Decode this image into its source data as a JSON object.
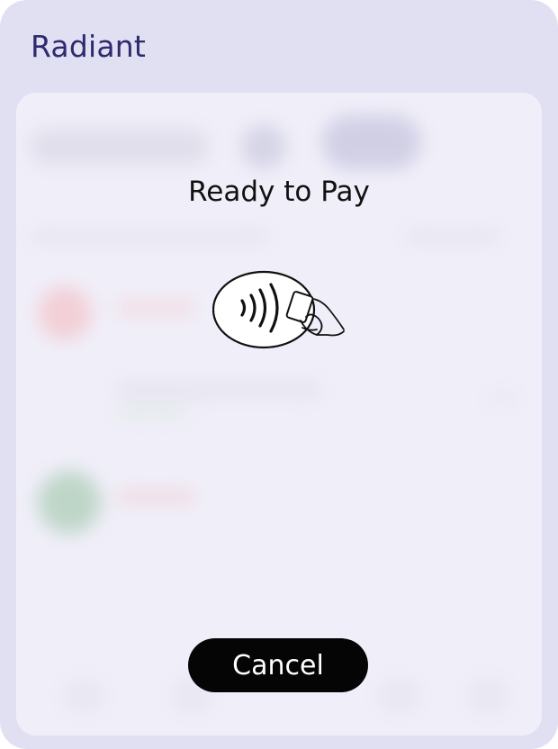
{
  "app": {
    "brand": "Radiant"
  },
  "payment_sheet": {
    "title": "Ready to Pay",
    "graphic_icon": "contactless-tap-icon",
    "cancel_label": "Cancel"
  },
  "colors": {
    "frame_bg": "#e1e0f3",
    "brand_text": "#2e2a6e",
    "card_bg": "#eeedf8",
    "button_bg": "#050505",
    "button_text": "#ffffff"
  }
}
